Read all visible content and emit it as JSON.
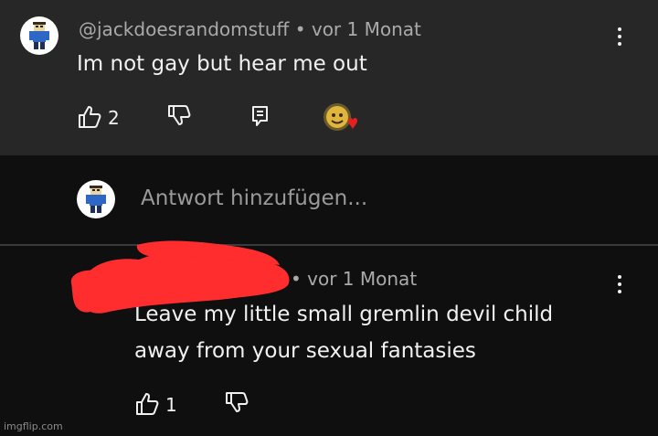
{
  "comment": {
    "author": "@jackdoesrandomstuff",
    "time": "vor 1 Monat",
    "text": "Im not gay but hear me out",
    "likes": "2"
  },
  "reply_box": {
    "placeholder": "Antwort hinzufügen..."
  },
  "reply": {
    "time": "vor 1 Monat",
    "text_line1": "Leave my little small gremlin devil child",
    "text_line2": "away from your sexual fantasies",
    "likes": "1"
  },
  "separator": "•",
  "watermark": "imgflip.com",
  "colors": {
    "background_top": "#272727",
    "background": "#0f0f0f",
    "redaction": "#ff2d2d",
    "heart": "#e5201e"
  }
}
